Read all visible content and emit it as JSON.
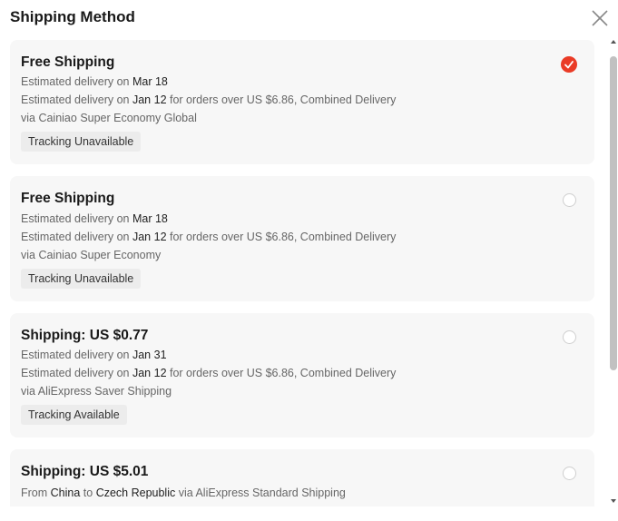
{
  "header": {
    "title": "Shipping Method"
  },
  "options": [
    {
      "title": "Free Shipping",
      "delivery_prefix": "Estimated delivery on ",
      "delivery_date": "Mar 18",
      "combined_prefix": "Estimated delivery on ",
      "combined_date": "Jan 12",
      "combined_suffix": " for orders over US $6.86, Combined Delivery",
      "carrier": "via Cainiao Super Economy Global",
      "tracking": "Tracking Unavailable",
      "selected": true
    },
    {
      "title": "Free Shipping",
      "delivery_prefix": "Estimated delivery on ",
      "delivery_date": "Mar 18",
      "combined_prefix": "Estimated delivery on ",
      "combined_date": "Jan 12",
      "combined_suffix": " for orders over US $6.86, Combined Delivery",
      "carrier": "via Cainiao Super Economy",
      "tracking": "Tracking Unavailable",
      "selected": false
    },
    {
      "title": "Shipping: US $0.77",
      "delivery_prefix": "Estimated delivery on ",
      "delivery_date": "Jan 31",
      "combined_prefix": "Estimated delivery on ",
      "combined_date": "Jan 12",
      "combined_suffix": " for orders over US $6.86, Combined Delivery",
      "carrier": "via AliExpress Saver Shipping",
      "tracking": "Tracking Available",
      "selected": false
    },
    {
      "title": "Shipping: US $5.01",
      "route_from_prefix": "From ",
      "route_from": "China",
      "route_to_prefix": " to ",
      "route_to": "Czech Republic",
      "route_suffix": " via AliExpress Standard Shipping",
      "selected": false
    }
  ],
  "colors": {
    "accent": "#ea3b26",
    "card_bg": "#f7f7f7",
    "tag_bg": "#ececec"
  },
  "icons": {
    "close": "close-icon",
    "selected": "check-icon"
  }
}
